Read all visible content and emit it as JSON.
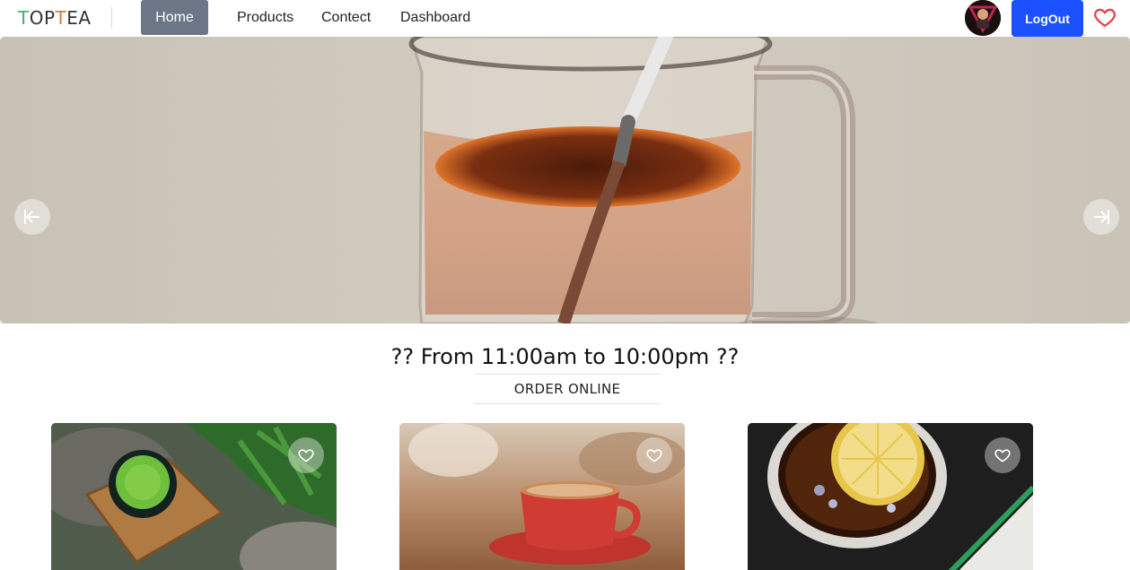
{
  "nav": {
    "logo": {
      "letter1": "T",
      "letter2": "OP",
      "letter3": "T",
      "letter4": "EA"
    },
    "links": [
      {
        "label": "Home",
        "active": true
      },
      {
        "label": "Products"
      },
      {
        "label": "Contect"
      },
      {
        "label": "Dashboard"
      }
    ],
    "logout_label": "LogOut",
    "accent_color": "#1a50ff",
    "active_color": "#6c7686",
    "heart_color": "#e5484d"
  },
  "hero": {
    "prev_icon": "arrow-left-to-line-icon",
    "next_icon": "arrow-right-to-line-icon"
  },
  "hours": {
    "text": "?? From 11:00am to 10:00pm ??"
  },
  "order": {
    "label": "ORDER ONLINE"
  },
  "products": [
    {
      "name": "matcha",
      "fav_icon": "heart-outline-icon"
    },
    {
      "name": "red-cup-coffee",
      "fav_icon": "heart-outline-icon"
    },
    {
      "name": "lemon-tea",
      "fav_icon": "heart-outline-icon"
    }
  ]
}
